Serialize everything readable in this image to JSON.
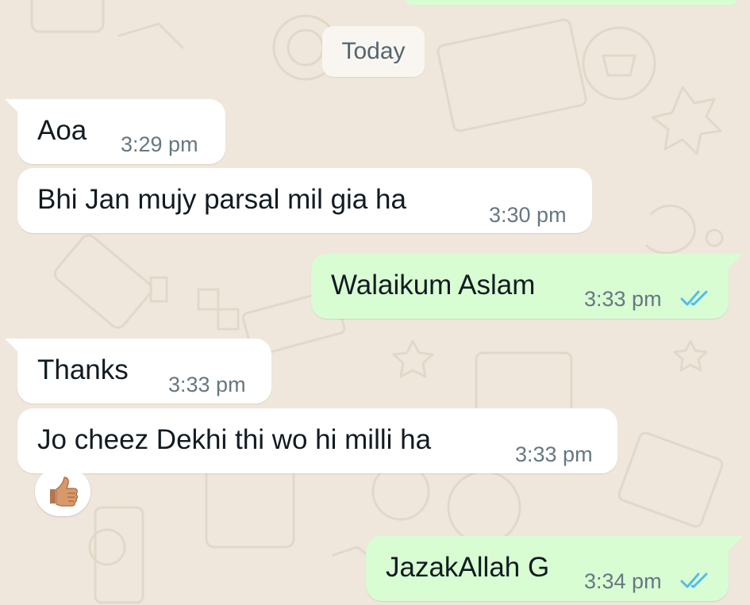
{
  "date_separator": "Today",
  "messages": [
    {
      "text": "Aoa",
      "time": "3:29 pm",
      "direction": "incoming"
    },
    {
      "text": "Bhi Jan mujy parsal mil gia ha",
      "time": "3:30 pm",
      "direction": "incoming"
    },
    {
      "text": "Walaikum Aslam",
      "time": "3:33 pm",
      "direction": "outgoing",
      "status": "read"
    },
    {
      "text": "Thanks",
      "time": "3:33 pm",
      "direction": "incoming"
    },
    {
      "text": "Jo cheez Dekhi thi wo hi milli ha",
      "time": "3:33 pm",
      "direction": "incoming",
      "reaction": "thumbs-up"
    },
    {
      "text": "JazakAllah G",
      "time": "3:34 pm",
      "direction": "outgoing",
      "status": "read"
    }
  ],
  "colors": {
    "wallpaper": "#efe7dc",
    "incoming_bubble": "#ffffff",
    "outgoing_bubble": "#d9fdd3",
    "read_tick": "#53bdeb",
    "timestamp": "#667781"
  }
}
